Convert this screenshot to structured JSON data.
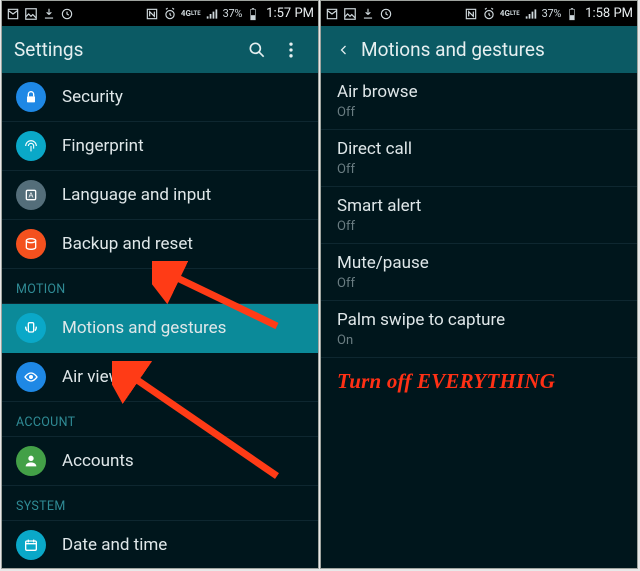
{
  "colors": {
    "accent": "#0b8a99",
    "arrow": "#ff3b16",
    "annot": "#ff3015"
  },
  "left": {
    "status": {
      "battery_text": "37%",
      "time": "1:57 PM"
    },
    "title": "Settings",
    "sections": [
      {
        "header": null,
        "items": [
          {
            "id": "security",
            "label": "Security",
            "icon": "lock-icon",
            "bg": "bg-blue"
          },
          {
            "id": "fingerprint",
            "label": "Fingerprint",
            "icon": "fingerprint-icon",
            "bg": "bg-cyan"
          },
          {
            "id": "language",
            "label": "Language and input",
            "icon": "language-icon",
            "bg": "bg-grey"
          },
          {
            "id": "backup",
            "label": "Backup and reset",
            "icon": "backup-icon",
            "bg": "bg-orange"
          }
        ]
      },
      {
        "header": "MOTION",
        "items": [
          {
            "id": "motions",
            "label": "Motions and gestures",
            "icon": "motions-icon",
            "bg": "bg-cyan",
            "selected": true
          },
          {
            "id": "airview",
            "label": "Air view",
            "icon": "airview-icon",
            "bg": "bg-blue"
          }
        ]
      },
      {
        "header": "ACCOUNT",
        "items": [
          {
            "id": "accounts",
            "label": "Accounts",
            "icon": "accounts-icon",
            "bg": "bg-green"
          }
        ]
      },
      {
        "header": "SYSTEM",
        "items": [
          {
            "id": "datetime",
            "label": "Date and time",
            "icon": "datetime-icon",
            "bg": "bg-cyan"
          }
        ]
      }
    ]
  },
  "right": {
    "status": {
      "battery_text": "37%",
      "time": "1:58 PM"
    },
    "title": "Motions and gestures",
    "items": [
      {
        "id": "airbrowse",
        "label": "Air browse",
        "state": "Off"
      },
      {
        "id": "directcall",
        "label": "Direct call",
        "state": "Off"
      },
      {
        "id": "smartalert",
        "label": "Smart alert",
        "state": "Off"
      },
      {
        "id": "mutepause",
        "label": "Mute/pause",
        "state": "Off"
      },
      {
        "id": "palmswipe",
        "label": "Palm swipe to capture",
        "state": "On"
      }
    ],
    "annotation": "Turn off EVERYTHING"
  }
}
